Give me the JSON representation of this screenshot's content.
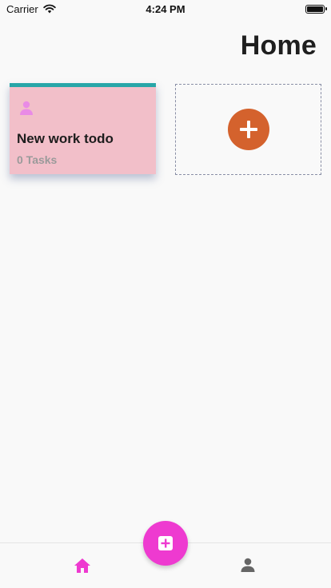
{
  "status_bar": {
    "carrier": "Carrier",
    "time": "4:24 PM",
    "wifi_icon": "wifi-icon",
    "battery_icon": "battery-icon"
  },
  "header": {
    "title": "Home"
  },
  "todo_cards": [
    {
      "title": "New work todo",
      "count": "0 Tasks",
      "icon": "person-icon",
      "background": "#f2bfc9",
      "accent": "#27a6a8",
      "icon_color": "#e98be6"
    }
  ],
  "add_tile": {
    "icon": "plus-circle-icon",
    "circle_color": "#d4622d"
  },
  "bottom_nav": {
    "items": [
      {
        "icon": "home-icon",
        "active": true,
        "color": "#ee3ad0"
      },
      {
        "icon": "person-icon",
        "active": false,
        "color": "#666666"
      }
    ],
    "fab": {
      "icon": "add-box-icon",
      "color": "#ee3ad0"
    }
  }
}
